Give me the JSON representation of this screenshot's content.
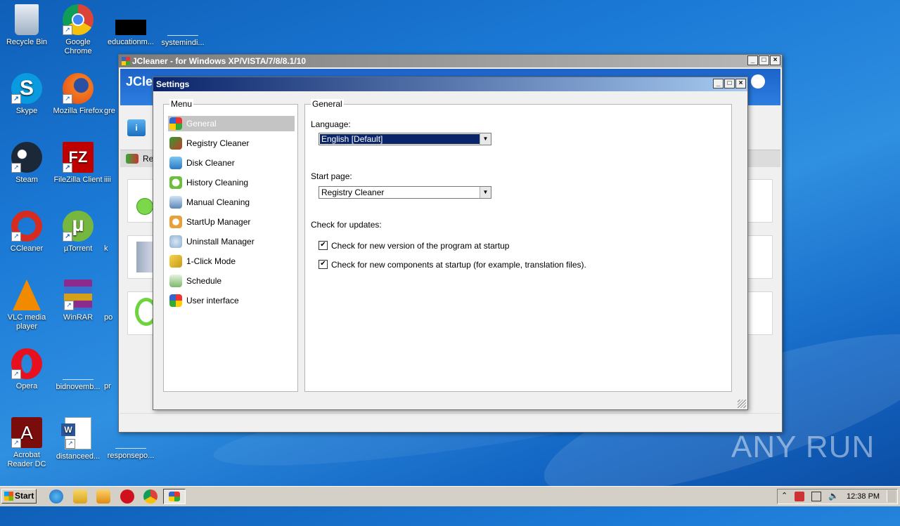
{
  "desktop": {
    "icons": [
      {
        "label": "Recycle Bin",
        "icon": "recycle-bin-icon"
      },
      {
        "label": "Google Chrome",
        "icon": "chrome-icon"
      },
      {
        "label": "educationm...",
        "icon": "file-icon"
      },
      {
        "label": "systemindi...",
        "icon": "file-icon"
      },
      {
        "label": "Skype",
        "icon": "skype-icon"
      },
      {
        "label": "Mozilla Firefox",
        "icon": "firefox-icon"
      },
      {
        "label": "gre",
        "icon": "file-icon"
      },
      {
        "label": "Steam",
        "icon": "steam-icon"
      },
      {
        "label": "FileZilla Client",
        "icon": "filezilla-icon"
      },
      {
        "label": "iiii",
        "icon": "file-icon"
      },
      {
        "label": "CCleaner",
        "icon": "ccleaner-icon"
      },
      {
        "label": "µTorrent",
        "icon": "utorrent-icon"
      },
      {
        "label": "k",
        "icon": "file-icon"
      },
      {
        "label": "VLC media player",
        "icon": "vlc-icon"
      },
      {
        "label": "WinRAR",
        "icon": "winrar-icon"
      },
      {
        "label": "po",
        "icon": "file-icon"
      },
      {
        "label": "Opera",
        "icon": "opera-icon"
      },
      {
        "label": "bidnovemb...",
        "icon": "file-icon"
      },
      {
        "label": "pr",
        "icon": "file-icon"
      },
      {
        "label": "Acrobat Reader DC",
        "icon": "acrobat-icon"
      },
      {
        "label": "distanceed...",
        "icon": "word-doc-icon"
      },
      {
        "label": "responsepo...",
        "icon": "file-icon"
      }
    ]
  },
  "main_window": {
    "title": "JCleaner - for Windows XP/VISTA/7/8/8.1/10",
    "header_text": "JCle",
    "tab_text": "Re",
    "buttons": {
      "minimize": "_",
      "maximize": "□",
      "close": "×"
    }
  },
  "settings": {
    "title": "Settings",
    "menu_title": "Menu",
    "menu": [
      {
        "label": "General",
        "icon": "general-icon",
        "selected": true
      },
      {
        "label": "Registry Cleaner",
        "icon": "registry-icon",
        "selected": false
      },
      {
        "label": "Disk Cleaner",
        "icon": "disk-icon",
        "selected": false
      },
      {
        "label": "History Cleaning",
        "icon": "history-icon",
        "selected": false
      },
      {
        "label": "Manual Cleaning",
        "icon": "manual-icon",
        "selected": false
      },
      {
        "label": "StartUp Manager",
        "icon": "startup-icon",
        "selected": false
      },
      {
        "label": "Uninstall Manager",
        "icon": "uninstall-icon",
        "selected": false
      },
      {
        "label": "1-Click Mode",
        "icon": "oneclick-icon",
        "selected": false
      },
      {
        "label": "Schedule",
        "icon": "schedule-icon",
        "selected": false
      },
      {
        "label": "User interface",
        "icon": "ui-icon",
        "selected": false
      }
    ],
    "general": {
      "group_title": "General",
      "language_label": "Language:",
      "language_value": "English [Default]",
      "startpage_label": "Start page:",
      "startpage_value": "Registry Cleaner",
      "updates_label": "Check for updates:",
      "check1": {
        "label": "Check for new version of the program at startup",
        "checked": true
      },
      "check2": {
        "label": "Check for new components at startup (for example, translation files).",
        "checked": true
      }
    }
  },
  "watermark": "ANY RUN",
  "taskbar": {
    "start_label": "Start",
    "clock": "12:38 PM"
  },
  "colors": {
    "title_active": "#0a246a",
    "title_inactive": "#7a96df",
    "selection": "#0a246a"
  }
}
